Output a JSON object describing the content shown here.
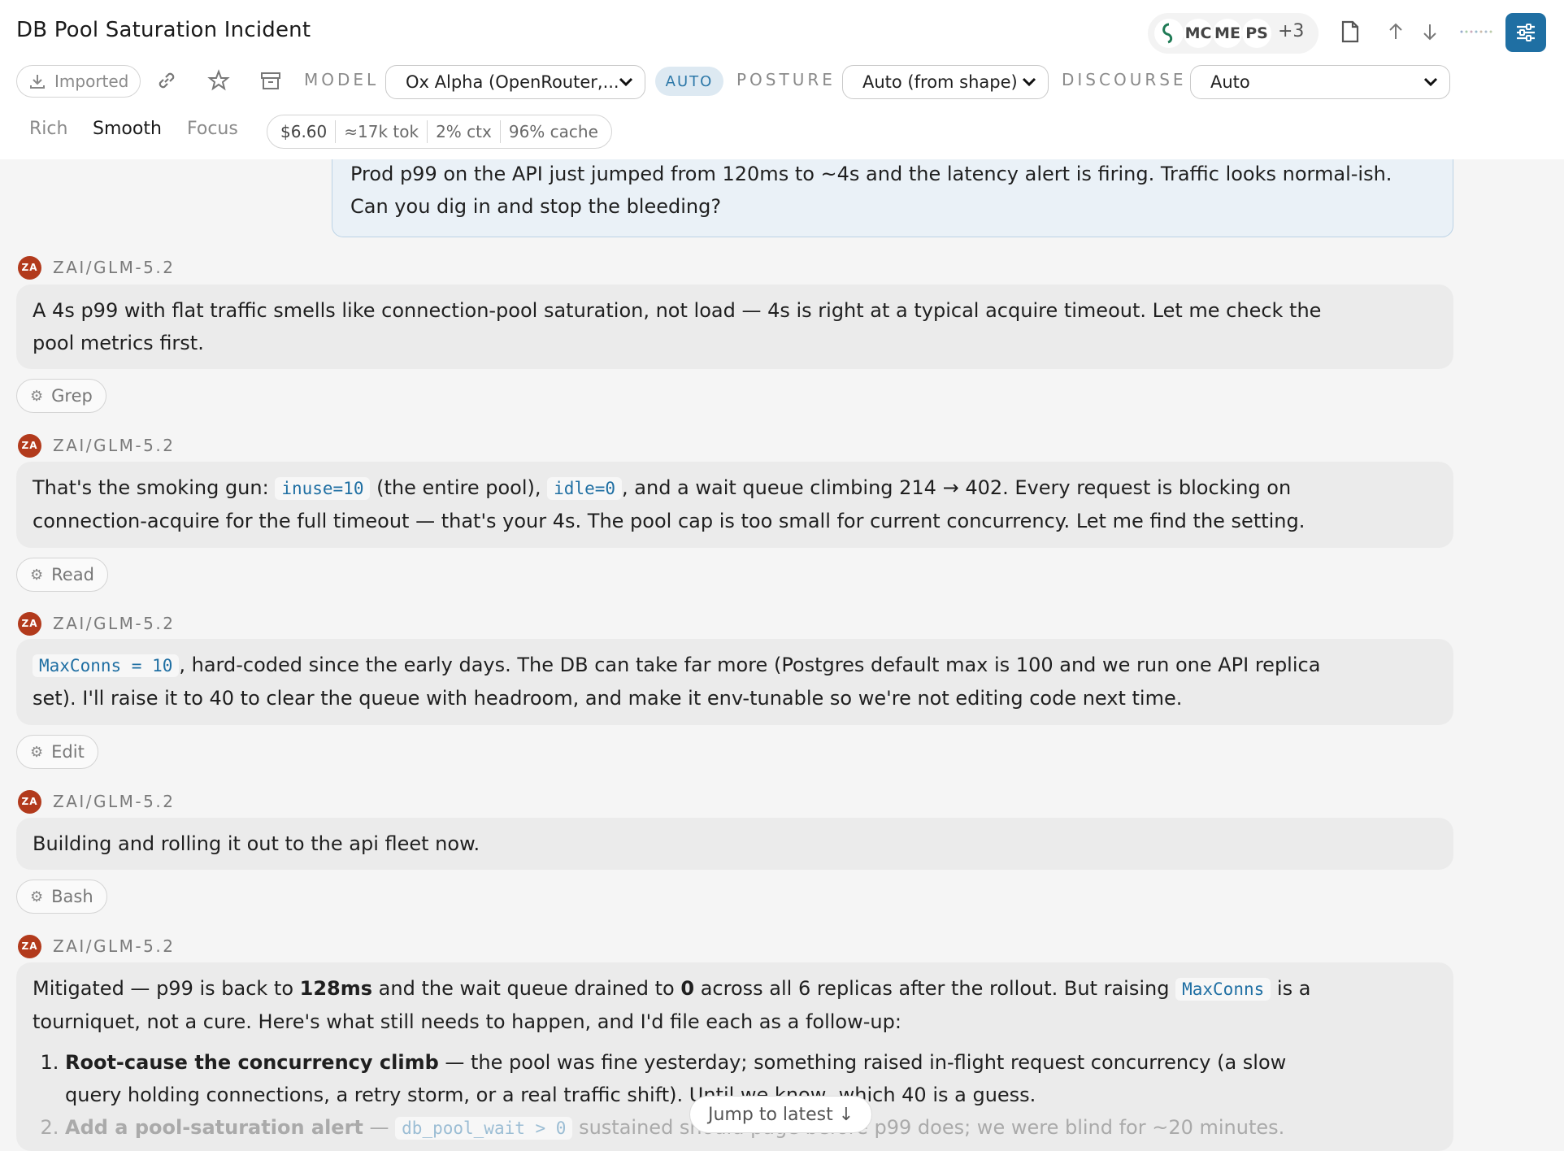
{
  "header": {
    "title": "DB Pool Saturation Incident",
    "collaborators": [
      "MC",
      "ME",
      "PS"
    ],
    "collaborators_more": "+3",
    "imported_label": "Imported",
    "model_label": "MODEL",
    "model_value": "Ox Alpha (OpenRouter,...",
    "auto_badge": "AUTO",
    "posture_label": "POSTURE",
    "posture_value": "Auto (from shape)",
    "discourse_label": "DISCOURSE",
    "discourse_value": "Auto",
    "view_modes": [
      "Rich",
      "Smooth",
      "Focus"
    ],
    "stats": {
      "cost": "$6.60",
      "tokens": "≈17k tok",
      "ctx": "2% ctx",
      "cache": "96% cache"
    },
    "colors": {
      "accent": "#1f6fa3",
      "agent_avatar": "#b23a1c"
    }
  },
  "chat": {
    "user_message": "Prod p99 on the API just jumped from 120ms to ~4s and the latency alert is firing. Traffic looks normal-ish. Can you dig in and stop the bleeding?",
    "agent_initials": "ZA",
    "agent_name": "ZAI/GLM-5.2",
    "messages": [
      {
        "text": "A 4s p99 with flat traffic smells like connection-pool saturation, not load — 4s is right at a typical acquire timeout. Let me check the pool metrics first.",
        "tool": "Grep"
      },
      {
        "parts": [
          "That's the smoking gun: ",
          "inuse=10",
          " (the entire pool), ",
          "idle=0",
          ", and a wait queue climbing 214 → 402. Every request is blocking on connection-acquire for the full timeout — that's your 4s. The pool cap is too small for current concurrency. Let me find the setting."
        ],
        "tool": "Read"
      },
      {
        "parts": [
          "MaxConns = 10",
          ", hard-coded since the early days. The DB can take far more (Postgres default max is 100 and we run one API replica set). I'll raise it to 40 to clear the queue with headroom, and make it env-tunable so we're not editing code next time."
        ],
        "tool": "Edit"
      },
      {
        "text": "Building and rolling it out to the api fleet now.",
        "tool": "Bash"
      },
      {
        "parts": [
          "Mitigated — p99 is back to ",
          "128ms",
          " and the wait queue drained to ",
          "0",
          " across all 6 replicas after the rollout. But raising ",
          "MaxConns",
          " is a tourniquet, not a cure. Here's what still needs to happen, and I'd file each as a follow-up:"
        ],
        "list": [
          {
            "bold": "Root-cause the concurrency climb",
            "text": " — the pool was fine yesterday; something raised in-flight request concurrency (a slow query holding connections, a retry storm, or a real traffic shift). Until we know, which 40 is a guess."
          },
          {
            "bold": "Add a pool-saturation alert",
            "pre": " — ",
            "code": "db_pool_wait > 0",
            "text": " sustained should page before p99 does; we were blind for ~20 minutes."
          }
        ]
      }
    ],
    "jump_label": "Jump to latest ↓"
  }
}
